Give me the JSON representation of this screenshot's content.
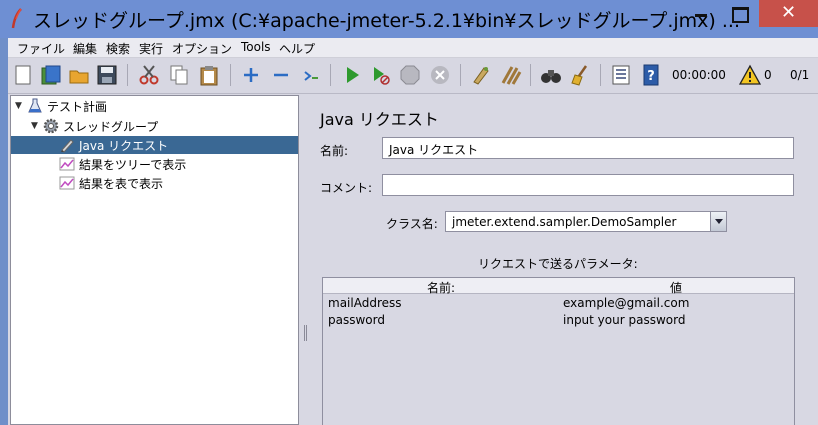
{
  "window": {
    "title": "スレッドグループ.jmx (C:¥apache-jmeter-5.2.1¥bin¥スレッドグループ.jmx) ...",
    "close_glyph": "✕"
  },
  "menu": [
    "ファイル",
    "編集",
    "検索",
    "実行",
    "オプション",
    "Tools",
    "ヘルプ"
  ],
  "toolbar": {
    "timer": "00:00:00",
    "warnings": "0",
    "threads": "0/1"
  },
  "tree": {
    "root": "テスト計画",
    "thread_group": "スレッドグループ",
    "items": [
      "Java リクエスト",
      "結果をツリーで表示",
      "結果を表で表示"
    ],
    "selected_index": 0
  },
  "panel": {
    "title": "Java リクエスト",
    "name_label": "名前:",
    "name_value": "Java リクエスト",
    "comment_label": "コメント:",
    "comment_value": "",
    "class_label": "クラス名:",
    "class_value": "jmeter.extend.sampler.DemoSampler",
    "params_title": "リクエストで送るパラメータ:",
    "params_headers": [
      "名前:",
      "値"
    ],
    "params": [
      {
        "name": "mailAddress",
        "value": "example@gmail.com"
      },
      {
        "name": "password",
        "value": "input your password"
      }
    ]
  }
}
